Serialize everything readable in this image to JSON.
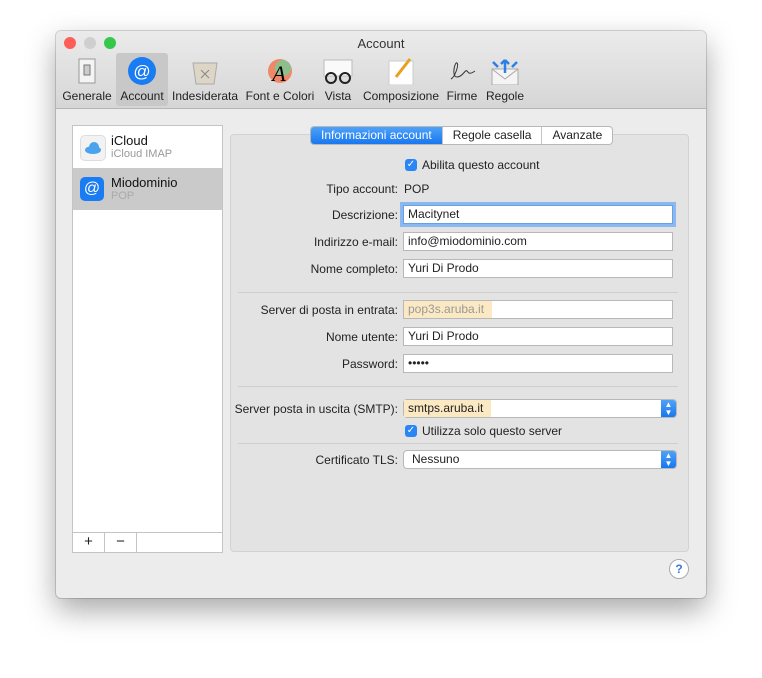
{
  "window": {
    "title": "Account"
  },
  "toolbar": [
    {
      "label": "Generale",
      "icon": "switch-icon"
    },
    {
      "label": "Account",
      "icon": "at-icon",
      "selected": true
    },
    {
      "label": "Indesiderata",
      "icon": "junk-bin-icon"
    },
    {
      "label": "Font e Colori",
      "icon": "font-colors-icon"
    },
    {
      "label": "Vista",
      "icon": "glasses-icon"
    },
    {
      "label": "Composizione",
      "icon": "pencil-icon"
    },
    {
      "label": "Firme",
      "icon": "signature-icon"
    },
    {
      "label": "Regole",
      "icon": "rules-envelope-icon"
    }
  ],
  "accounts": [
    {
      "name": "iCloud",
      "type": "iCloud IMAP"
    },
    {
      "name": "Miodominio",
      "type": "POP",
      "selected": true
    }
  ],
  "list_buttons": {
    "add": "+",
    "remove": "−"
  },
  "tabs": [
    {
      "label": "Informazioni account",
      "selected": true
    },
    {
      "label": "Regole casella"
    },
    {
      "label": "Avanzate"
    }
  ],
  "form": {
    "enable_label": "Abilita questo account",
    "enable_checked": true,
    "type_label": "Tipo account:",
    "type_value": "POP",
    "desc_label": "Descrizione:",
    "desc_value": "Macitynet",
    "email_label": "Indirizzo e-mail:",
    "email_value": "info@miodominio.com",
    "fullname_label": "Nome completo:",
    "fullname_value": "Yuri Di Prodo",
    "incoming_label": "Server di posta in entrata:",
    "incoming_value": "pop3s.aruba.it",
    "user_label": "Nome utente:",
    "user_value": "Yuri Di Prodo",
    "password_label": "Password:",
    "password_value": "•••••",
    "smtp_label": "Server posta in uscita (SMTP):",
    "smtp_value": "smtps.aruba.it",
    "only_server_label": "Utilizza solo questo server",
    "only_server_checked": true,
    "tls_label": "Certificato TLS:",
    "tls_value": "Nessuno"
  },
  "help": "?",
  "colors": {
    "accent": "#1877f0",
    "highlight": "#fbe9c3"
  }
}
